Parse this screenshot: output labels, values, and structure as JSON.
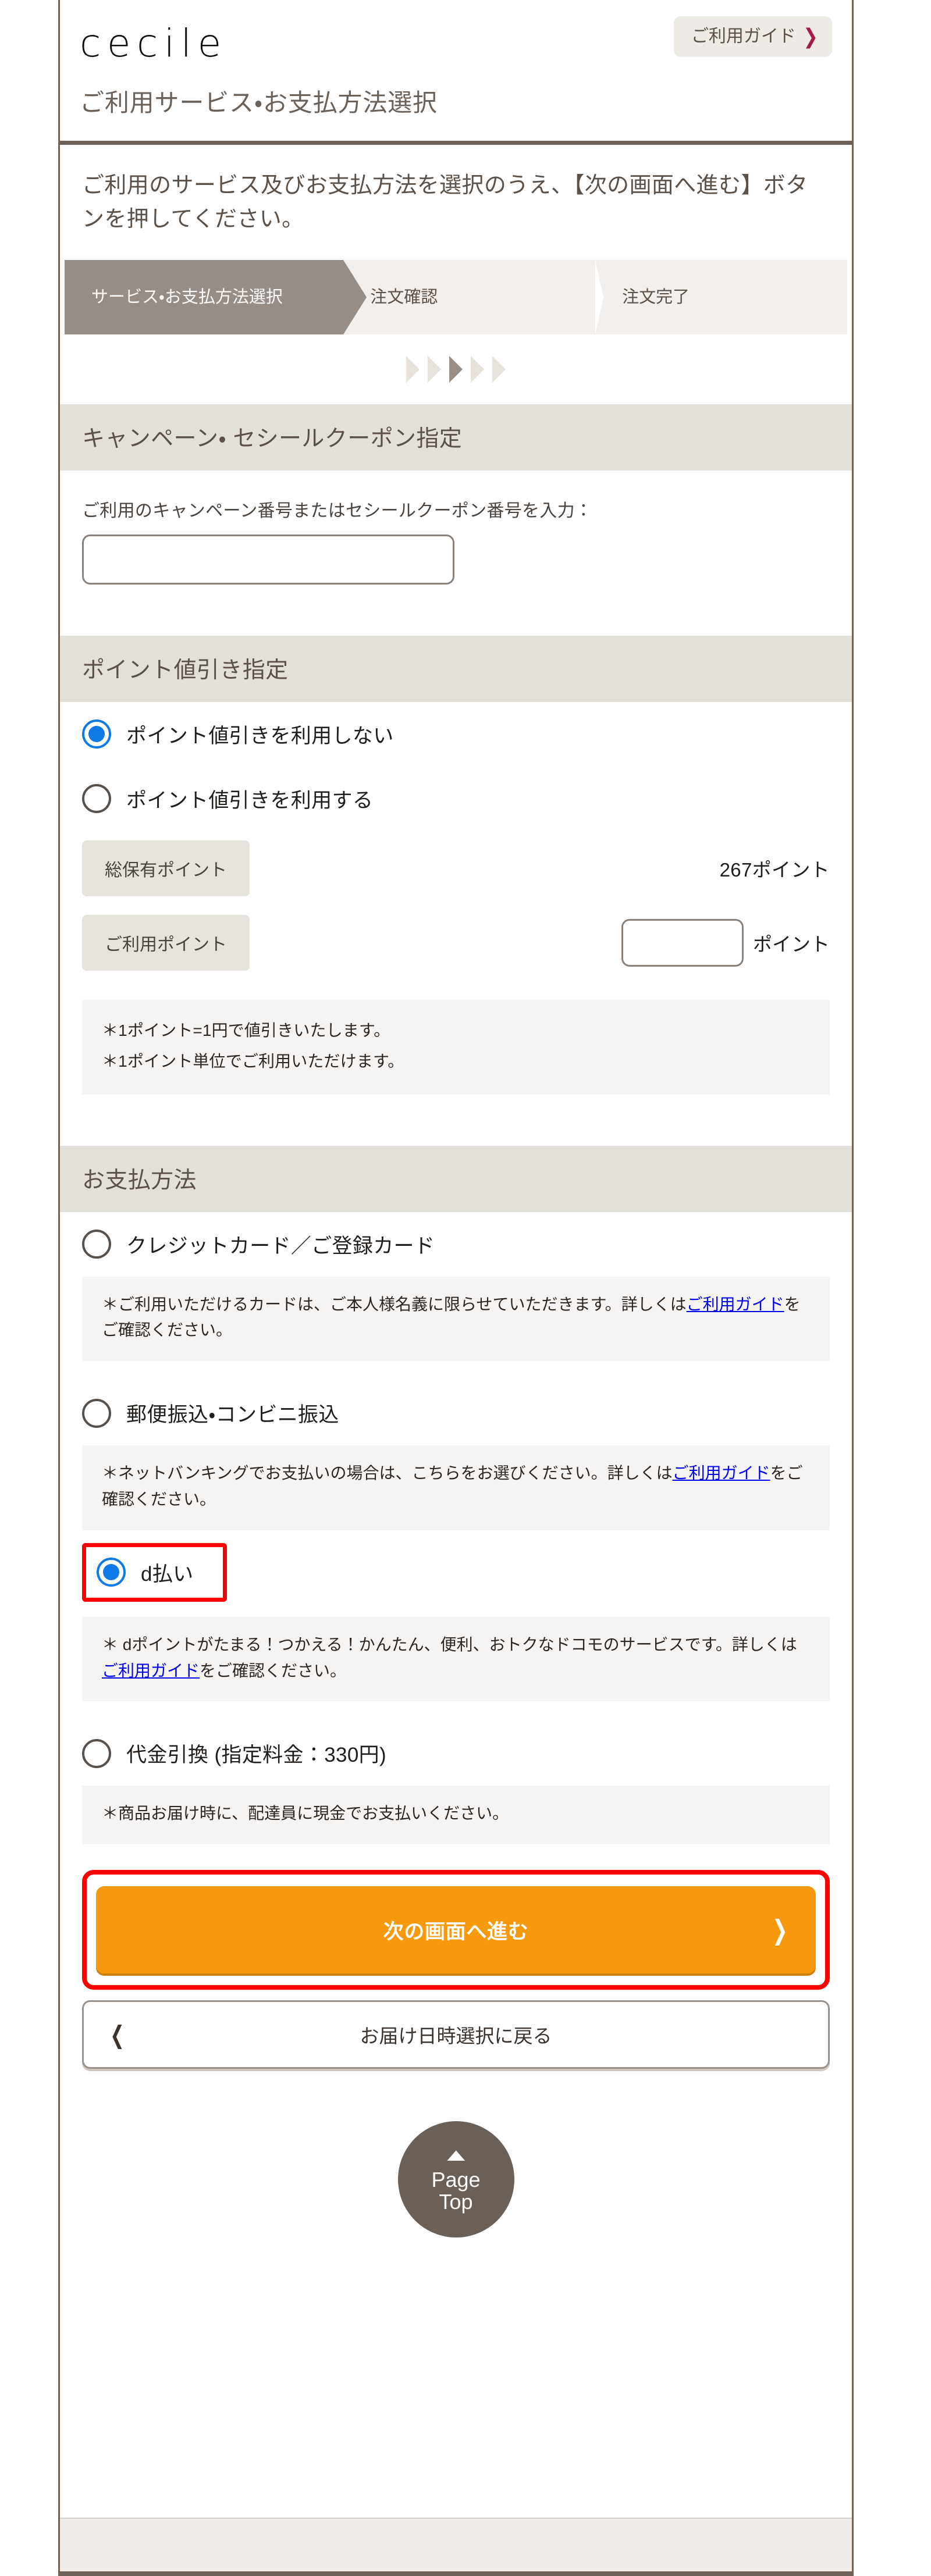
{
  "brand": {
    "logo": "cecile"
  },
  "header": {
    "guide_button": "ご利用ガイド",
    "guide_chevron_icon": "chevron-right-icon",
    "guide_chevron_color": "#a61b4c",
    "page_title": "ご利用サービス・お支払方法選択"
  },
  "intro": {
    "text": "ご利用のサービス及びお支払方法を選択のうえ、【次の画面へ進む】ボタンを押してください。"
  },
  "steps": {
    "items": [
      {
        "label": "サービス・お支払方法選択",
        "active": true
      },
      {
        "label": "注文確認",
        "active": false
      },
      {
        "label": "注文完了",
        "active": false
      }
    ],
    "active_color": "#968d87",
    "inactive_color": "#f2efec",
    "arrow_count": 5,
    "arrow_highlight_index": 2
  },
  "campaign": {
    "section_title": "キャンペーン・ セシールクーポン指定",
    "field_label": "ご利用のキャンペーン番号またはセシールクーポン番号を入力：",
    "input_value": "",
    "input_placeholder": ""
  },
  "points": {
    "section_title": "ポイント値引き指定",
    "options": [
      {
        "label": "ポイント値引きを利用しない",
        "selected": true
      },
      {
        "label": "ポイント値引きを利用する",
        "selected": false
      }
    ],
    "total_label": "総保有ポイント",
    "total_value": "267ポイント",
    "use_label": "ご利用ポイント",
    "use_input_value": "",
    "use_unit": "ポイント",
    "notes": [
      "＊1ポイント=1円で値引きいたします。",
      "＊1ポイント単位でご利用いただけます。"
    ]
  },
  "payment": {
    "section_title": "お支払方法",
    "methods": [
      {
        "label": "クレジットカード／ご登録カード",
        "selected": false,
        "highlighted": false,
        "note_prefix": "＊ご利用いただけるカードは、ご本人様名義に限らせていただきます。詳しくは",
        "note_link": "ご利用ガイド",
        "note_suffix": "をご確認ください。"
      },
      {
        "label": "郵便振込・コンビニ振込",
        "selected": false,
        "highlighted": false,
        "note_prefix": "＊ネットバンキングでお支払いの場合は、こちらをお選びください。詳しくは",
        "note_link": "ご利用ガイド",
        "note_suffix": "をご確認ください。"
      },
      {
        "label": "d払い",
        "selected": true,
        "highlighted": true,
        "note_prefix": "＊ dポイントがたまる！つかえる！かんたん、便利、おトクなドコモのサービスです。詳しくは",
        "note_link": "ご利用ガイド",
        "note_suffix": "をご確認ください。"
      },
      {
        "label": "代金引換 (指定料金：330円)",
        "selected": false,
        "highlighted": false,
        "note_prefix": "＊商品お届け時に、配達員に現金でお支払いください。",
        "note_link": "",
        "note_suffix": ""
      }
    ]
  },
  "actions": {
    "next_label": "次の画面へ進む",
    "next_chevron_icon": "chevron-right-icon",
    "next_color": "#f7990d",
    "next_highlighted": true,
    "highlight_color": "#ff0000",
    "back_label": "お届け日時選択に戻る",
    "back_chevron_icon": "chevron-left-icon"
  },
  "pagetop": {
    "caret_icon": "chevron-up-icon",
    "line1": "Page",
    "line2": "Top"
  }
}
